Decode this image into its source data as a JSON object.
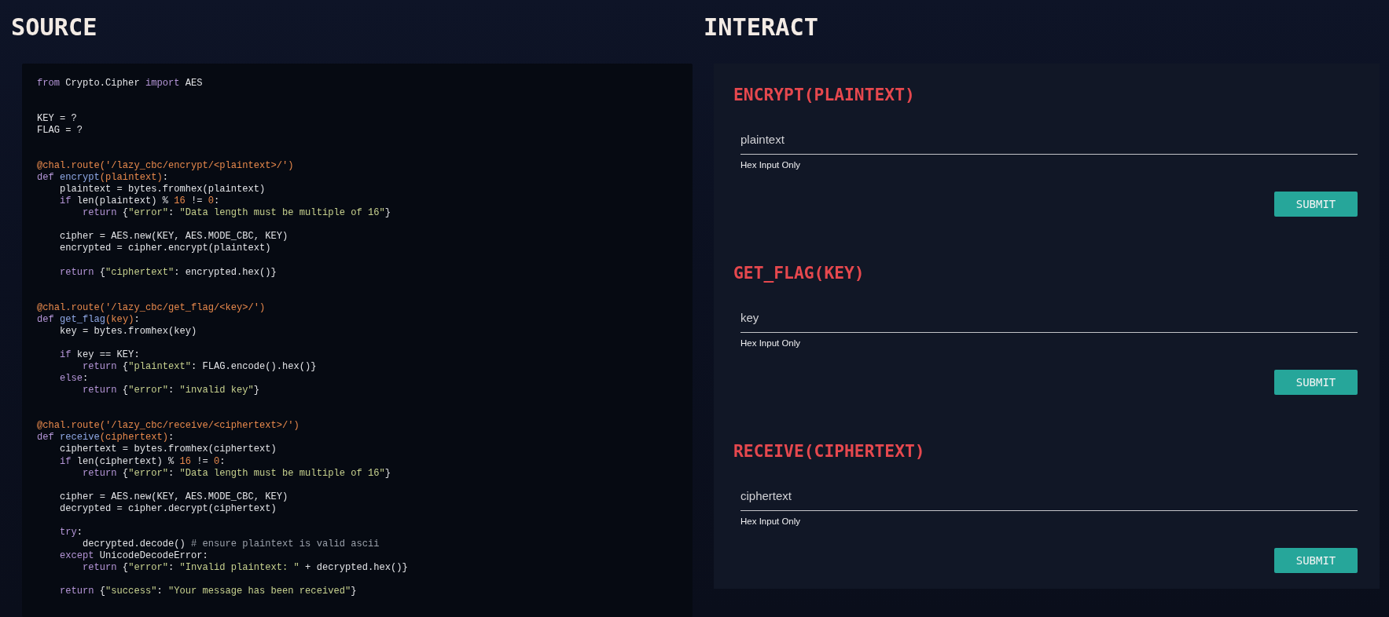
{
  "source": {
    "title": "SOURCE",
    "code": {
      "sections": [
        {
          "paragraphs": [
            {
              "lines": [
                {
                  "tokens": [
                    {
                      "kind": "keyword",
                      "text": "from"
                    },
                    {
                      "kind": "plain",
                      "text": " Crypto.Cipher "
                    },
                    {
                      "kind": "keyword",
                      "text": "import"
                    },
                    {
                      "kind": "plain",
                      "text": " AES"
                    }
                  ]
                }
              ]
            }
          ]
        },
        {
          "paragraphs": [
            {
              "lines": [
                {
                  "tokens": [
                    {
                      "kind": "plain",
                      "text": "KEY = ?"
                    }
                  ]
                },
                {
                  "tokens": [
                    {
                      "kind": "plain",
                      "text": "FLAG = ?"
                    }
                  ]
                }
              ]
            }
          ]
        },
        {
          "paragraphs": [
            {
              "lines": [
                {
                  "tokens": [
                    {
                      "kind": "decorator",
                      "text": "@chal.route('/lazy_cbc/encrypt/<plaintext>/')"
                    }
                  ]
                },
                {
                  "tokens": [
                    {
                      "kind": "keyword",
                      "text": "def"
                    },
                    {
                      "kind": "function",
                      "text": " encrypt"
                    },
                    {
                      "kind": "param",
                      "text": "(plaintext)"
                    },
                    {
                      "kind": "plain",
                      "text": ":"
                    }
                  ]
                },
                {
                  "tokens": [
                    {
                      "kind": "plain",
                      "text": "    plaintext = bytes.fromhex(plaintext)"
                    }
                  ]
                },
                {
                  "tokens": [
                    {
                      "kind": "keyword",
                      "text": "    if"
                    },
                    {
                      "kind": "plain",
                      "text": " len(plaintext) % "
                    },
                    {
                      "kind": "number",
                      "text": "16"
                    },
                    {
                      "kind": "plain",
                      "text": " != "
                    },
                    {
                      "kind": "number",
                      "text": "0"
                    },
                    {
                      "kind": "plain",
                      "text": ":"
                    }
                  ]
                },
                {
                  "tokens": [
                    {
                      "kind": "keyword",
                      "text": "        return"
                    },
                    {
                      "kind": "plain",
                      "text": " {"
                    },
                    {
                      "kind": "string",
                      "text": "\"error\""
                    },
                    {
                      "kind": "plain",
                      "text": ": "
                    },
                    {
                      "kind": "string",
                      "text": "\"Data length must be multiple of 16\""
                    },
                    {
                      "kind": "plain",
                      "text": "}"
                    }
                  ]
                }
              ]
            },
            {
              "lines": [
                {
                  "tokens": [
                    {
                      "kind": "plain",
                      "text": "    cipher = AES.new(KEY, AES.MODE_CBC, KEY)"
                    }
                  ]
                },
                {
                  "tokens": [
                    {
                      "kind": "plain",
                      "text": "    encrypted = cipher.encrypt(plaintext)"
                    }
                  ]
                }
              ]
            },
            {
              "lines": [
                {
                  "tokens": [
                    {
                      "kind": "keyword",
                      "text": "    return"
                    },
                    {
                      "kind": "plain",
                      "text": " {"
                    },
                    {
                      "kind": "string",
                      "text": "\"ciphertext\""
                    },
                    {
                      "kind": "plain",
                      "text": ": encrypted.hex()}"
                    }
                  ]
                }
              ]
            }
          ]
        },
        {
          "paragraphs": [
            {
              "lines": [
                {
                  "tokens": [
                    {
                      "kind": "decorator",
                      "text": "@chal.route('/lazy_cbc/get_flag/<key>/')"
                    }
                  ]
                },
                {
                  "tokens": [
                    {
                      "kind": "keyword",
                      "text": "def"
                    },
                    {
                      "kind": "function",
                      "text": " get_flag"
                    },
                    {
                      "kind": "param",
                      "text": "(key)"
                    },
                    {
                      "kind": "plain",
                      "text": ":"
                    }
                  ]
                },
                {
                  "tokens": [
                    {
                      "kind": "plain",
                      "text": "    key = bytes.fromhex(key)"
                    }
                  ]
                }
              ]
            },
            {
              "lines": [
                {
                  "tokens": [
                    {
                      "kind": "keyword",
                      "text": "    if"
                    },
                    {
                      "kind": "plain",
                      "text": " key == KEY:"
                    }
                  ]
                },
                {
                  "tokens": [
                    {
                      "kind": "keyword",
                      "text": "        return"
                    },
                    {
                      "kind": "plain",
                      "text": " {"
                    },
                    {
                      "kind": "string",
                      "text": "\"plaintext\""
                    },
                    {
                      "kind": "plain",
                      "text": ": FLAG.encode().hex()}"
                    }
                  ]
                },
                {
                  "tokens": [
                    {
                      "kind": "keyword",
                      "text": "    else"
                    },
                    {
                      "kind": "plain",
                      "text": ":"
                    }
                  ]
                },
                {
                  "tokens": [
                    {
                      "kind": "keyword",
                      "text": "        return"
                    },
                    {
                      "kind": "plain",
                      "text": " {"
                    },
                    {
                      "kind": "string",
                      "text": "\"error\""
                    },
                    {
                      "kind": "plain",
                      "text": ": "
                    },
                    {
                      "kind": "string",
                      "text": "\"invalid key\""
                    },
                    {
                      "kind": "plain",
                      "text": "}"
                    }
                  ]
                }
              ]
            }
          ]
        },
        {
          "paragraphs": [
            {
              "lines": [
                {
                  "tokens": [
                    {
                      "kind": "decorator",
                      "text": "@chal.route('/lazy_cbc/receive/<ciphertext>/')"
                    }
                  ]
                },
                {
                  "tokens": [
                    {
                      "kind": "keyword",
                      "text": "def"
                    },
                    {
                      "kind": "function",
                      "text": " receive"
                    },
                    {
                      "kind": "param",
                      "text": "(ciphertext)"
                    },
                    {
                      "kind": "plain",
                      "text": ":"
                    }
                  ]
                },
                {
                  "tokens": [
                    {
                      "kind": "plain",
                      "text": "    ciphertext = bytes.fromhex(ciphertext)"
                    }
                  ]
                },
                {
                  "tokens": [
                    {
                      "kind": "keyword",
                      "text": "    if"
                    },
                    {
                      "kind": "plain",
                      "text": " len(ciphertext) % "
                    },
                    {
                      "kind": "number",
                      "text": "16"
                    },
                    {
                      "kind": "plain",
                      "text": " != "
                    },
                    {
                      "kind": "number",
                      "text": "0"
                    },
                    {
                      "kind": "plain",
                      "text": ":"
                    }
                  ]
                },
                {
                  "tokens": [
                    {
                      "kind": "keyword",
                      "text": "        return"
                    },
                    {
                      "kind": "plain",
                      "text": " {"
                    },
                    {
                      "kind": "string",
                      "text": "\"error\""
                    },
                    {
                      "kind": "plain",
                      "text": ": "
                    },
                    {
                      "kind": "string",
                      "text": "\"Data length must be multiple of 16\""
                    },
                    {
                      "kind": "plain",
                      "text": "}"
                    }
                  ]
                }
              ]
            },
            {
              "lines": [
                {
                  "tokens": [
                    {
                      "kind": "plain",
                      "text": "    cipher = AES.new(KEY, AES.MODE_CBC, KEY)"
                    }
                  ]
                },
                {
                  "tokens": [
                    {
                      "kind": "plain",
                      "text": "    decrypted = cipher.decrypt(ciphertext)"
                    }
                  ]
                }
              ]
            },
            {
              "lines": [
                {
                  "tokens": [
                    {
                      "kind": "keyword",
                      "text": "    try"
                    },
                    {
                      "kind": "plain",
                      "text": ":"
                    }
                  ]
                },
                {
                  "tokens": [
                    {
                      "kind": "plain",
                      "text": "        decrypted.decode() "
                    },
                    {
                      "kind": "comment",
                      "text": "# ensure plaintext is valid ascii"
                    }
                  ]
                },
                {
                  "tokens": [
                    {
                      "kind": "keyword",
                      "text": "    except"
                    },
                    {
                      "kind": "plain",
                      "text": " UnicodeDecodeError:"
                    }
                  ]
                },
                {
                  "tokens": [
                    {
                      "kind": "keyword",
                      "text": "        return"
                    },
                    {
                      "kind": "plain",
                      "text": " {"
                    },
                    {
                      "kind": "string",
                      "text": "\"error\""
                    },
                    {
                      "kind": "plain",
                      "text": ": "
                    },
                    {
                      "kind": "string",
                      "text": "\"Invalid plaintext: \""
                    },
                    {
                      "kind": "plain",
                      "text": " + decrypted.hex()}"
                    }
                  ]
                }
              ]
            },
            {
              "lines": [
                {
                  "tokens": [
                    {
                      "kind": "keyword",
                      "text": "    return"
                    },
                    {
                      "kind": "plain",
                      "text": " {"
                    },
                    {
                      "kind": "string",
                      "text": "\"success\""
                    },
                    {
                      "kind": "plain",
                      "text": ": "
                    },
                    {
                      "kind": "string",
                      "text": "\"Your message has been received\""
                    },
                    {
                      "kind": "plain",
                      "text": "}"
                    }
                  ]
                }
              ]
            }
          ]
        }
      ]
    }
  },
  "interact": {
    "title": "INTERACT",
    "forms": [
      {
        "title": "ENCRYPT(PLAINTEXT)",
        "input": {
          "placeholder": "plaintext"
        },
        "hint": "Hex Input Only",
        "button": "SUBMIT"
      },
      {
        "title": "GET_FLAG(KEY)",
        "input": {
          "placeholder": "key"
        },
        "hint": "Hex Input Only",
        "button": "SUBMIT"
      },
      {
        "title": "RECEIVE(CIPHERTEXT)",
        "input": {
          "placeholder": "ciphertext"
        },
        "hint": "Hex Input Only",
        "button": "SUBMIT"
      }
    ]
  }
}
